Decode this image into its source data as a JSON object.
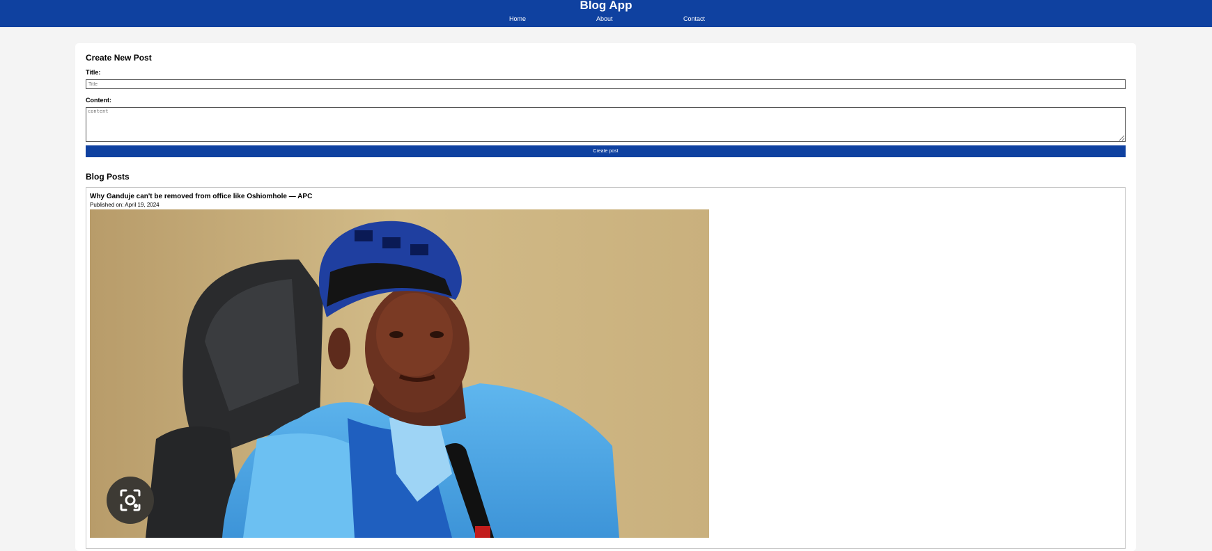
{
  "header": {
    "title": "Blog App",
    "nav": [
      "Home",
      "About",
      "Contact"
    ]
  },
  "create_form": {
    "heading": "Create New Post",
    "title_label": "Title:",
    "title_placeholder": "Title",
    "title_value": "",
    "content_label": "Content:",
    "content_placeholder": "content",
    "content_value": "",
    "submit_label": "Create post"
  },
  "posts_section": {
    "heading": "Blog Posts",
    "posts": [
      {
        "title": "Why Ganduje can't be removed from office like Oshiomhole — APC",
        "date": "Published on: April 19, 2024",
        "image": "photo-of-man-in-blue-agbada-and-cap-seated-at-microphone"
      }
    ]
  },
  "overlay": {
    "lens_button_icon": "camera-search-icon"
  },
  "colors": {
    "brand": "#0f41a0",
    "page_background": "#f4f4f4",
    "card_background": "#ffffff"
  }
}
